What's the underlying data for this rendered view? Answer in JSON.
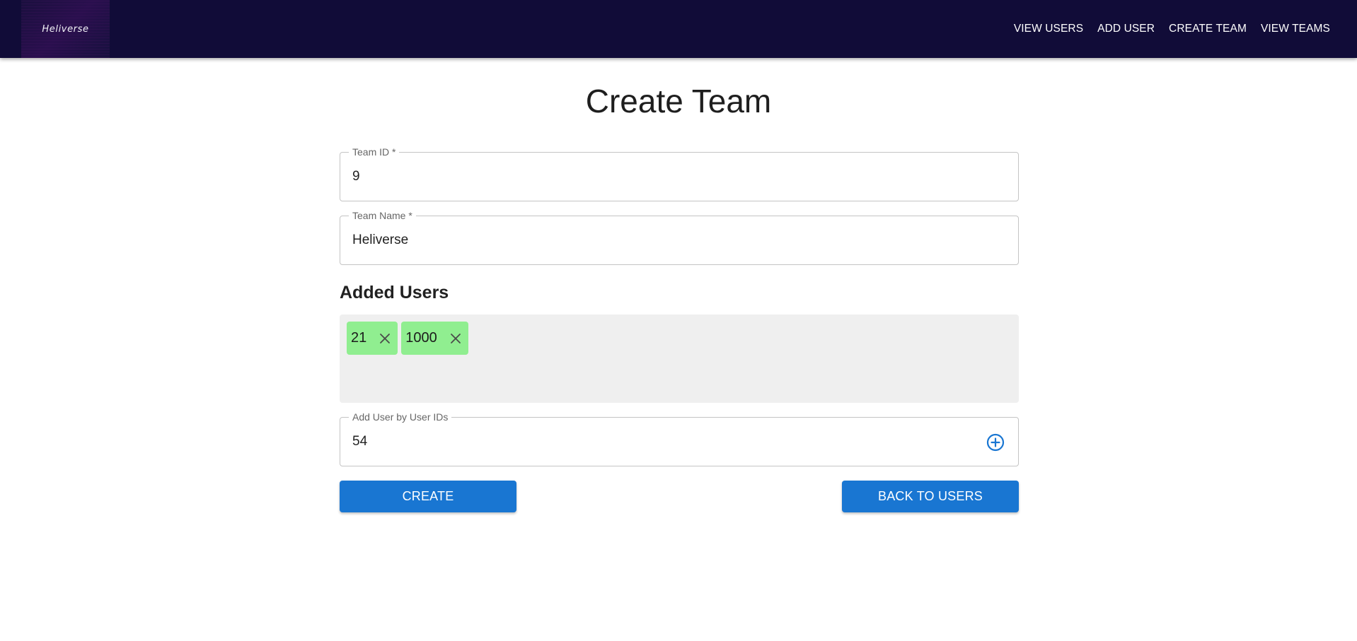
{
  "navbar": {
    "logo_text": "Heliverse",
    "links": [
      "VIEW USERS",
      "ADD USER",
      "CREATE TEAM",
      "VIEW TEAMS"
    ]
  },
  "page": {
    "title": "Create Team"
  },
  "form": {
    "team_id": {
      "label": "Team ID *",
      "value": "9"
    },
    "team_name": {
      "label": "Team Name *",
      "value": "Heliverse"
    },
    "added_users": {
      "heading": "Added Users",
      "chips": [
        "21",
        "1000"
      ],
      "chip_color": "#90ee90"
    },
    "add_user": {
      "label": "Add User by User IDs",
      "value": "54",
      "icon": "add-circle-outline-icon"
    }
  },
  "actions": {
    "create_label": "CREATE",
    "back_label": "BACK TO USERS",
    "button_color": "#1976d2"
  },
  "colors": {
    "navbar_bg": "#110c38",
    "users_box_bg": "#efefef"
  }
}
